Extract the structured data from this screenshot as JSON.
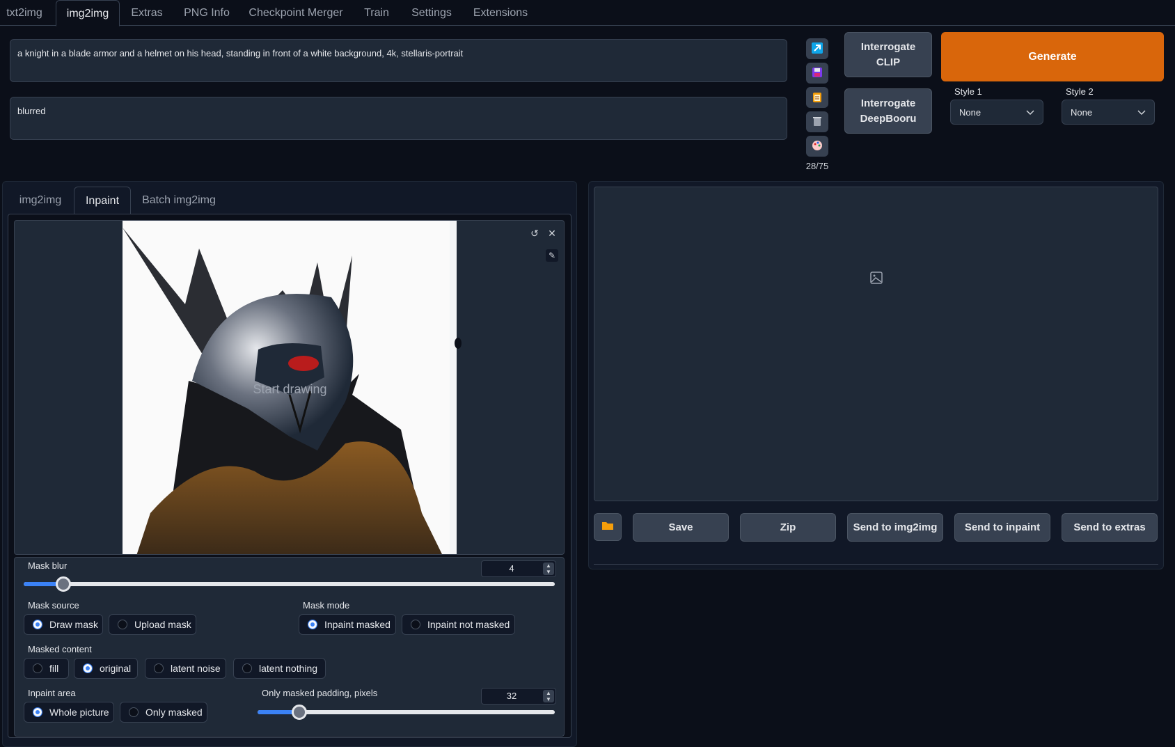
{
  "top_tabs": [
    "txt2img",
    "img2img",
    "Extras",
    "PNG Info",
    "Checkpoint Merger",
    "Train",
    "Settings",
    "Extensions"
  ],
  "prompt": "a knight in a blade armor and a helmet on his head, standing in front of a white background, 4k, stellaris-portrait",
  "negative_prompt": "blurred",
  "token_count": "28/75",
  "icons": {
    "paste": "arrow-icon",
    "save_style": "floppy-disk-icon",
    "apply_style": "clipboard-icon",
    "clear": "trash-icon",
    "extra_networks": "palette-icon"
  },
  "buttons": {
    "interrogate_clip": "Interrogate CLIP",
    "interrogate_deepbooru": "Interrogate DeepBooru",
    "generate": "Generate"
  },
  "styles": {
    "style1_label": "Style 1",
    "style1_value": "None",
    "style2_label": "Style 2",
    "style2_value": "None"
  },
  "sub_tabs": [
    "img2img",
    "Inpaint",
    "Batch img2img"
  ],
  "canvas": {
    "placeholder": "Start drawing"
  },
  "mask_blur": {
    "label": "Mask blur",
    "value": "4",
    "fraction": 0.075
  },
  "mask_source": {
    "label": "Mask source",
    "options": [
      "Draw mask",
      "Upload mask"
    ],
    "selected": "Draw mask"
  },
  "mask_mode": {
    "label": "Mask mode",
    "options": [
      "Inpaint masked",
      "Inpaint not masked"
    ],
    "selected": "Inpaint masked"
  },
  "masked_content": {
    "label": "Masked content",
    "options": [
      "fill",
      "original",
      "latent noise",
      "latent nothing"
    ],
    "selected": "original"
  },
  "inpaint_area": {
    "label": "Inpaint area",
    "options": [
      "Whole picture",
      "Only masked"
    ],
    "selected": "Whole picture"
  },
  "padding": {
    "label": "Only masked padding, pixels",
    "value": "32",
    "fraction": 0.125
  },
  "output_buttons": {
    "save": "Save",
    "zip": "Zip",
    "send_img2img": "Send to img2img",
    "send_inpaint": "Send to inpaint",
    "send_extras": "Send to extras"
  },
  "colors": {
    "accent": "#3b82f6",
    "generate": "#d9660b",
    "background": "#0b0f19",
    "panel": "#1f2937"
  }
}
